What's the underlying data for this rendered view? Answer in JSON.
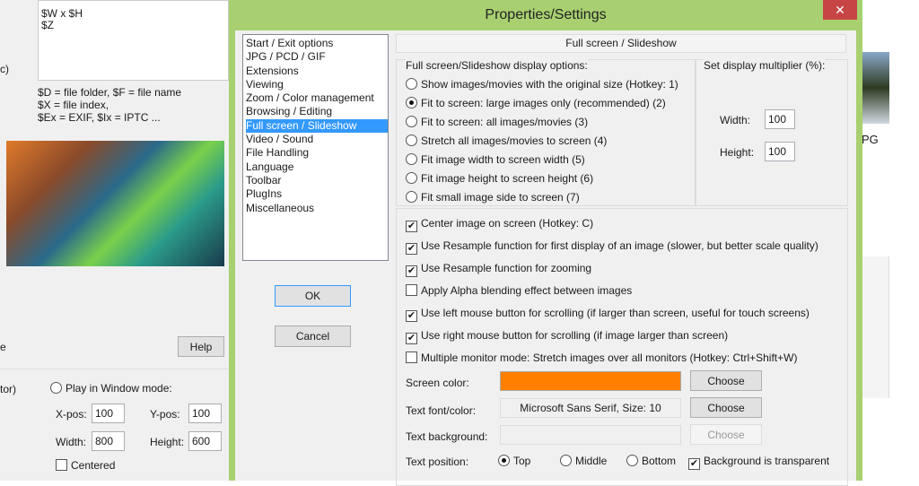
{
  "background_window": {
    "text_box_lines": [
      "$W x $H",
      "$Z"
    ],
    "hint_lines": [
      "$D = file folder, $F = file name",
      "$X = file index,",
      "$Ex = EXIF, $Ix = IPTC ..."
    ],
    "left_fragments": [
      "c)",
      "e",
      "tor)"
    ],
    "help_label": "Help",
    "play_window_label": "Play in Window mode:",
    "xpos_label": "X-pos:",
    "xpos_value": "100",
    "ypos_label": "Y-pos:",
    "ypos_value": "100",
    "width_label": "Width:",
    "width_value": "800",
    "height_label": "Height:",
    "height_value": "600",
    "centered_label": "Centered",
    "thumb_caption": "PG"
  },
  "dialog": {
    "title": "Properties/Settings",
    "close_glyph": "✕",
    "categories": [
      "Start / Exit options",
      "JPG / PCD / GIF",
      "Extensions",
      "Viewing",
      "Zoom / Color management",
      "Browsing / Editing",
      "Full screen / Slideshow",
      "Video / Sound",
      "File Handling",
      "Language",
      "Toolbar",
      "PlugIns",
      "Miscellaneous"
    ],
    "selected_category": "Full screen / Slideshow",
    "ok_label": "OK",
    "cancel_label": "Cancel",
    "section_title": "Full screen / Slideshow",
    "display_options_label": "Full screen/Slideshow display options:",
    "display_options": [
      {
        "label": "Show images/movies with the original size (Hotkey: 1)",
        "selected": false
      },
      {
        "label": "Fit to screen: large images only (recommended) (2)",
        "selected": true
      },
      {
        "label": "Fit to screen: all images/movies (3)",
        "selected": false
      },
      {
        "label": "Stretch all images/movies to screen (4)",
        "selected": false
      },
      {
        "label": "Fit image width to screen width (5)",
        "selected": false
      },
      {
        "label": "Fit image height to screen height (6)",
        "selected": false
      },
      {
        "label": "Fit small image side to screen (7)",
        "selected": false
      }
    ],
    "multiplier_label": "Set display multiplier (%):",
    "mult_width_label": "Width:",
    "mult_width_value": "100",
    "mult_height_label": "Height:",
    "mult_height_value": "100",
    "checkboxes": [
      {
        "label": "Center image on screen (Hotkey: C)",
        "checked": true
      },
      {
        "label": "Use Resample function for first display of an image (slower, but better scale quality)",
        "checked": true
      },
      {
        "label": "Use Resample function for zooming",
        "checked": true
      },
      {
        "label": "Apply Alpha blending effect between images",
        "checked": false
      },
      {
        "label": "Use left mouse button for scrolling (if larger than screen, useful for touch screens)",
        "checked": true
      },
      {
        "label": "Use right mouse button for scrolling (if image larger than screen)",
        "checked": true
      },
      {
        "label": "Multiple monitor mode: Stretch images over all monitors (Hotkey: Ctrl+Shift+W)",
        "checked": false
      }
    ],
    "screen_color_label": "Screen color:",
    "screen_color": "#ff8000",
    "text_font_label": "Text font/color:",
    "text_font_value": "Microsoft Sans Serif, Size: 10",
    "text_background_label": "Text background:",
    "choose_label": "Choose",
    "text_position_label": "Text position:",
    "text_position_options": [
      "Top",
      "Middle",
      "Bottom"
    ],
    "text_position_selected": "Top",
    "bg_transparent_label": "Background is transparent"
  },
  "colors": {
    "dialog_border": "#a8d070",
    "close_button": "#c74545",
    "selection": "#3399ff"
  }
}
